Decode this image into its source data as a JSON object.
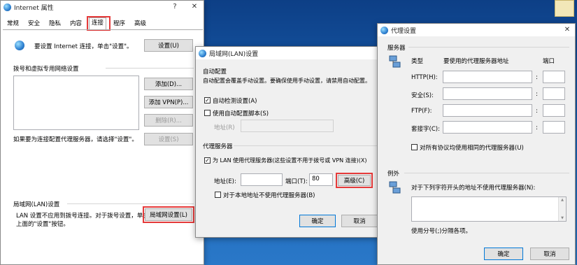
{
  "inet": {
    "title": "Internet 属性",
    "help": "?",
    "close": "✕",
    "tabs": [
      "常规",
      "安全",
      "隐私",
      "内容",
      "连接",
      "程序",
      "高级"
    ],
    "setup_text": "要设置 Internet 连接，单击\"设置\"。",
    "setup_btn": "设置(U)",
    "dialup_label": "拨号和虚拟专用网络设置",
    "add_btn": "添加(D)...",
    "add_vpn_btn": "添加 VPN(P)...",
    "remove_btn": "删除(R)...",
    "settings_btn": "设置(S)",
    "proxy_hint": "如果要为连接配置代理服务器，请选择\"设置\"。",
    "lan_group": "局域网(LAN)设置",
    "lan_text_1": "LAN 设置不应用到拨号连接。对于拨号设置，单击",
    "lan_text_2": "上面的\"设置\"按钮。",
    "lan_btn": "局域网设置(L)"
  },
  "lan": {
    "title": "局域网(LAN)设置",
    "auto_group": "自动配置",
    "auto_desc": "自动配置会覆盖手动设置。要确保使用手动设置，请禁用自动配置。",
    "auto_detect": "自动检测设置(A)",
    "auto_script": "使用自动配置脚本(S)",
    "address_label": "地址(R)",
    "proxy_group": "代理服务器",
    "use_proxy": "为 LAN 使用代理服务器(这些设置不用于拨号或 VPN 连接)(X)",
    "addr_label": "地址(E):",
    "port_label": "端口(T):",
    "port_value": "80",
    "advanced_btn": "高级(C)",
    "bypass_local": "对于本地地址不使用代理服务器(B)",
    "ok_btn": "确定",
    "cancel_btn": "取消",
    "check_mark": "✓"
  },
  "proxy": {
    "title": "代理设置",
    "close": "✕",
    "servers_group": "服务器",
    "col_type": "类型",
    "col_addr": "要使用的代理服务器地址",
    "col_port": "端口",
    "rows": [
      "HTTP(H):",
      "安全(S):",
      "FTP(F):",
      "套接字(C):"
    ],
    "colon": ":",
    "same_for_all": "对所有协议均使用相同的代理服务器(U)",
    "exceptions_group": "例外",
    "exceptions_desc": "对于下列字符开头的地址不使用代理服务器(N):",
    "exceptions_hint": "使用分号(;)分隔各项。",
    "ok_btn": "确定",
    "cancel_btn": "取消",
    "scroll_up": "▲",
    "scroll_down": "▼"
  },
  "colors": {
    "highlight_red": "#e53a3a",
    "focus_blue": "#0078d7"
  }
}
